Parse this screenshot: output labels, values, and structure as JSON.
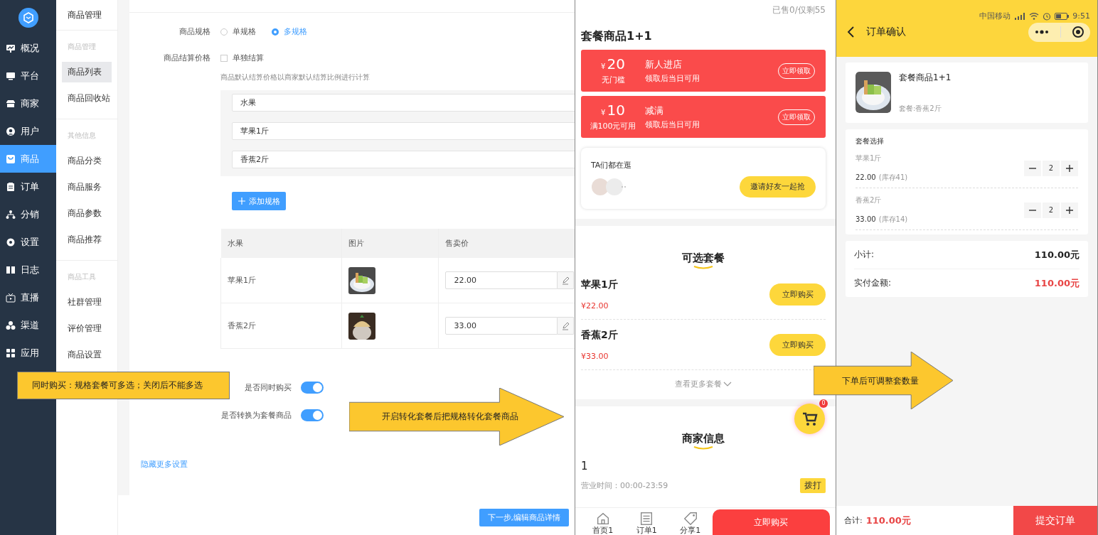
{
  "sidebar": {
    "items": [
      {
        "label": "概况",
        "kind": "overview",
        "selected": false
      },
      {
        "label": "平台",
        "kind": "platform",
        "selected": false
      },
      {
        "label": "商家",
        "kind": "merchant",
        "selected": false
      },
      {
        "label": "用户",
        "kind": "user",
        "selected": false
      },
      {
        "label": "商品",
        "kind": "goods",
        "selected": true
      },
      {
        "label": "订单",
        "kind": "order",
        "selected": false
      },
      {
        "label": "分销",
        "kind": "distribution",
        "selected": false
      },
      {
        "label": "设置",
        "kind": "settings",
        "selected": false
      },
      {
        "label": "日志",
        "kind": "log",
        "selected": false
      },
      {
        "label": "直播",
        "kind": "live",
        "selected": false
      },
      {
        "label": "渠道",
        "kind": "channel",
        "selected": false
      },
      {
        "label": "应用",
        "kind": "apps",
        "selected": false
      }
    ]
  },
  "subnav": {
    "title": "商品管理",
    "groups": [
      {
        "heading": "商品管理",
        "items": [
          {
            "label": "商品列表",
            "selected": true
          },
          {
            "label": "商品回收站",
            "selected": false
          }
        ]
      },
      {
        "heading": "其他信息",
        "items": [
          {
            "label": "商品分类",
            "selected": false
          },
          {
            "label": "商品服务",
            "selected": false
          },
          {
            "label": "商品参数",
            "selected": false
          },
          {
            "label": "商品推荐",
            "selected": false
          }
        ]
      },
      {
        "heading": "商品工具",
        "items": [
          {
            "label": "社群管理",
            "selected": false
          },
          {
            "label": "评价管理",
            "selected": false
          },
          {
            "label": "商品设置",
            "selected": false
          }
        ]
      }
    ]
  },
  "form": {
    "spec": {
      "label": "商品规格",
      "options": [
        {
          "label": "单规格",
          "selected": false
        },
        {
          "label": "多规格",
          "selected": true
        }
      ]
    },
    "settlement": {
      "label": "商品结算价格",
      "checkbox": {
        "label": "单独结算",
        "checked": false
      },
      "hint": "商品默认结算价格以商家默认结算比例进行计算"
    },
    "spec_values": [
      "水果",
      "苹果1斤",
      "香蕉2斤"
    ],
    "add_button": "添加规格",
    "table": {
      "columns": [
        "水果",
        "图片",
        "售卖价"
      ],
      "rows": [
        {
          "name": "苹果1斤",
          "price": "22.00"
        },
        {
          "name": "香蕉2斤",
          "price": "33.00"
        }
      ]
    },
    "toggles": [
      {
        "label": "是否同时购买",
        "on": true
      },
      {
        "label": "是否转换为套餐商品",
        "on": true
      }
    ],
    "more_link": "隐藏更多设置",
    "next_button": "下一步,编辑商品详情"
  },
  "product_page": {
    "sold": "已售0/仅剩55",
    "title": "套餐商品1+1",
    "coupons": [
      {
        "currency": "¥",
        "amount": "20",
        "condition": "无门槛",
        "name": "新人进店",
        "note": "领取后当日可用",
        "button": "立即领取"
      },
      {
        "currency": "¥",
        "amount": "10",
        "condition": "满100元可用",
        "name": "减满",
        "note": "领取后当日可用",
        "button": "立即领取"
      }
    ],
    "browsing": {
      "title": "TA们都在逛",
      "button": "邀请好友一起抢"
    },
    "packages": {
      "title": "可选套餐",
      "items": [
        {
          "name": "苹果1斤",
          "price": "¥22.00",
          "button": "立即购买"
        },
        {
          "name": "香蕉2斤",
          "price": "¥33.00",
          "button": "立即购买"
        }
      ],
      "more": "查看更多套餐"
    },
    "cart_badge": "0",
    "merchant": {
      "title": "商家信息",
      "name": "1",
      "hours": "营业时间：00:00-23:59",
      "call": "拨打"
    },
    "tabbar": [
      {
        "label": "首页1",
        "kind": "home"
      },
      {
        "label": "订单1",
        "kind": "orders"
      },
      {
        "label": "分享1",
        "kind": "share"
      }
    ],
    "buy_button": "立即购买"
  },
  "order_page": {
    "status": {
      "carrier": "中国移动",
      "time": "9:51"
    },
    "title": "订单确认",
    "product": {
      "name": "套餐商品1+1",
      "variant": "套餐:香蕉2斤"
    },
    "selection": {
      "title": "套餐选择",
      "items": [
        {
          "name": "苹果1斤",
          "price": "22.00",
          "stock": "(库存41)",
          "qty": "2"
        },
        {
          "name": "香蕉2斤",
          "price": "33.00",
          "stock": "(库存14)",
          "qty": "2"
        }
      ]
    },
    "summary": [
      {
        "label": "小计:",
        "value": "110.00元",
        "kind": "plain"
      },
      {
        "label": "实付金额:",
        "value": "110.00元",
        "kind": "accent"
      }
    ],
    "footer": {
      "label": "合计:",
      "total": "110.00元",
      "submit": "提交订单"
    }
  },
  "callouts": [
    {
      "kind": "note",
      "text": "同时购买：规格套餐可多选；关闭后不能多选"
    },
    {
      "kind": "arrow",
      "text": "开启转化套餐后把规格转化套餐商品"
    },
    {
      "kind": "arrow",
      "text": "下单后可调整套数量"
    }
  ]
}
